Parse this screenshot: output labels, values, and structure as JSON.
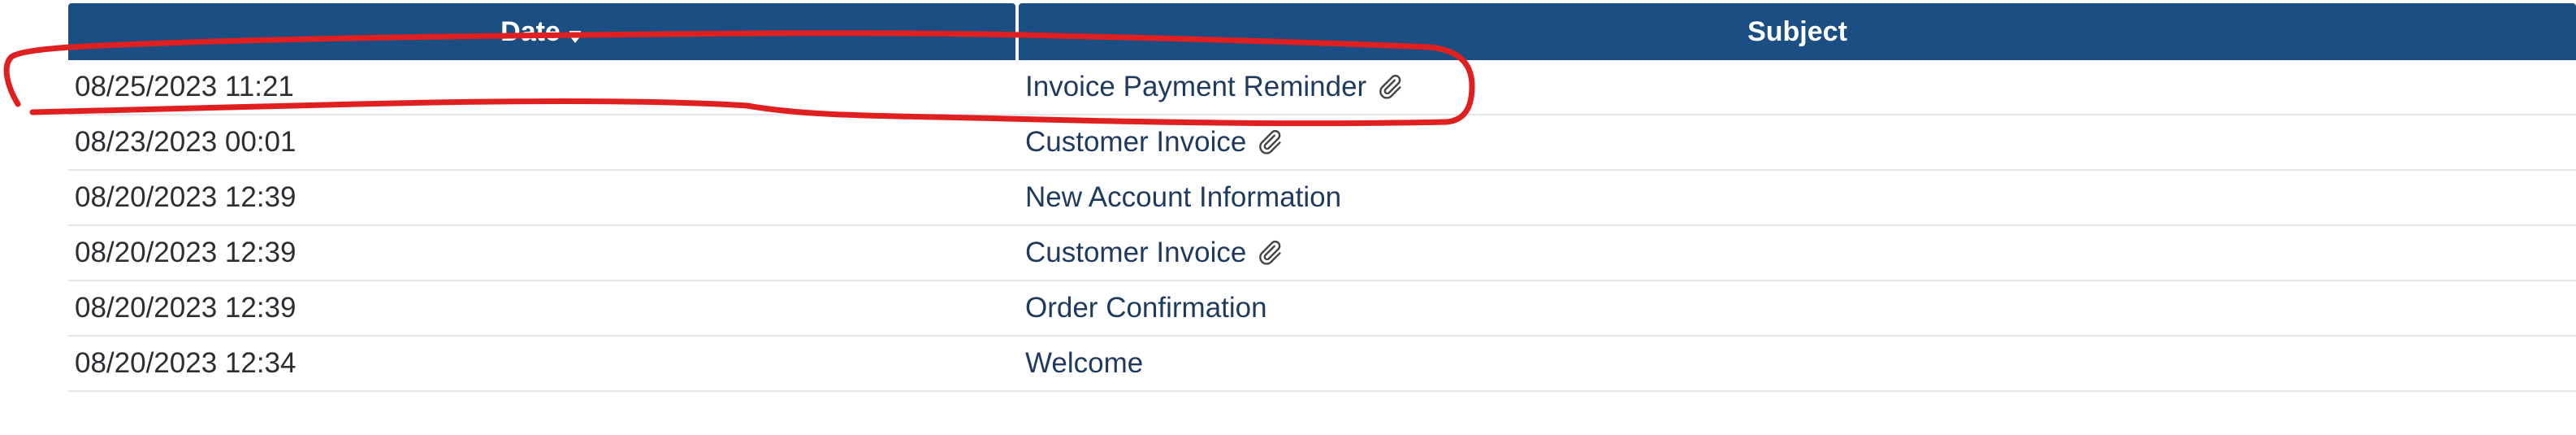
{
  "table": {
    "columns": [
      {
        "label": "Date",
        "sort_icon": "sort-descending-icon"
      },
      {
        "label": "Subject"
      }
    ],
    "rows": [
      {
        "date": "08/25/2023 11:21",
        "subject": "Invoice Payment Reminder",
        "attachment": true
      },
      {
        "date": "08/23/2023 00:01",
        "subject": "Customer Invoice",
        "attachment": true
      },
      {
        "date": "08/20/2023 12:39",
        "subject": "New Account Information",
        "attachment": false
      },
      {
        "date": "08/20/2023 12:39",
        "subject": "Customer Invoice",
        "attachment": true
      },
      {
        "date": "08/20/2023 12:39",
        "subject": "Order Confirmation",
        "attachment": false
      },
      {
        "date": "08/20/2023 12:34",
        "subject": "Welcome",
        "attachment": false
      }
    ]
  },
  "annotation": {
    "color": "#e02020",
    "icon": "red-hand-drawn-circle"
  }
}
